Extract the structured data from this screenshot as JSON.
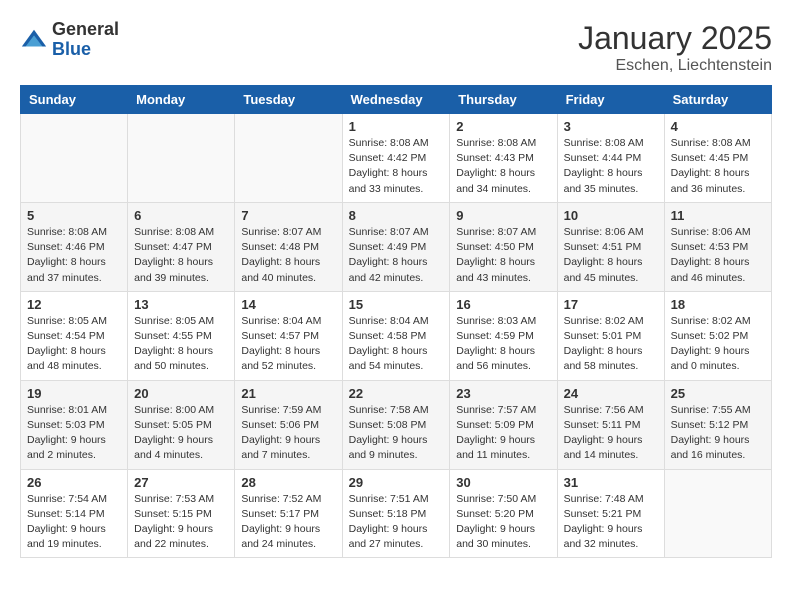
{
  "header": {
    "logo_general": "General",
    "logo_blue": "Blue",
    "month": "January 2025",
    "location": "Eschen, Liechtenstein"
  },
  "weekdays": [
    "Sunday",
    "Monday",
    "Tuesday",
    "Wednesday",
    "Thursday",
    "Friday",
    "Saturday"
  ],
  "weeks": [
    [
      {
        "day": "",
        "info": ""
      },
      {
        "day": "",
        "info": ""
      },
      {
        "day": "",
        "info": ""
      },
      {
        "day": "1",
        "info": "Sunrise: 8:08 AM\nSunset: 4:42 PM\nDaylight: 8 hours\nand 33 minutes."
      },
      {
        "day": "2",
        "info": "Sunrise: 8:08 AM\nSunset: 4:43 PM\nDaylight: 8 hours\nand 34 minutes."
      },
      {
        "day": "3",
        "info": "Sunrise: 8:08 AM\nSunset: 4:44 PM\nDaylight: 8 hours\nand 35 minutes."
      },
      {
        "day": "4",
        "info": "Sunrise: 8:08 AM\nSunset: 4:45 PM\nDaylight: 8 hours\nand 36 minutes."
      }
    ],
    [
      {
        "day": "5",
        "info": "Sunrise: 8:08 AM\nSunset: 4:46 PM\nDaylight: 8 hours\nand 37 minutes."
      },
      {
        "day": "6",
        "info": "Sunrise: 8:08 AM\nSunset: 4:47 PM\nDaylight: 8 hours\nand 39 minutes."
      },
      {
        "day": "7",
        "info": "Sunrise: 8:07 AM\nSunset: 4:48 PM\nDaylight: 8 hours\nand 40 minutes."
      },
      {
        "day": "8",
        "info": "Sunrise: 8:07 AM\nSunset: 4:49 PM\nDaylight: 8 hours\nand 42 minutes."
      },
      {
        "day": "9",
        "info": "Sunrise: 8:07 AM\nSunset: 4:50 PM\nDaylight: 8 hours\nand 43 minutes."
      },
      {
        "day": "10",
        "info": "Sunrise: 8:06 AM\nSunset: 4:51 PM\nDaylight: 8 hours\nand 45 minutes."
      },
      {
        "day": "11",
        "info": "Sunrise: 8:06 AM\nSunset: 4:53 PM\nDaylight: 8 hours\nand 46 minutes."
      }
    ],
    [
      {
        "day": "12",
        "info": "Sunrise: 8:05 AM\nSunset: 4:54 PM\nDaylight: 8 hours\nand 48 minutes."
      },
      {
        "day": "13",
        "info": "Sunrise: 8:05 AM\nSunset: 4:55 PM\nDaylight: 8 hours\nand 50 minutes."
      },
      {
        "day": "14",
        "info": "Sunrise: 8:04 AM\nSunset: 4:57 PM\nDaylight: 8 hours\nand 52 minutes."
      },
      {
        "day": "15",
        "info": "Sunrise: 8:04 AM\nSunset: 4:58 PM\nDaylight: 8 hours\nand 54 minutes."
      },
      {
        "day": "16",
        "info": "Sunrise: 8:03 AM\nSunset: 4:59 PM\nDaylight: 8 hours\nand 56 minutes."
      },
      {
        "day": "17",
        "info": "Sunrise: 8:02 AM\nSunset: 5:01 PM\nDaylight: 8 hours\nand 58 minutes."
      },
      {
        "day": "18",
        "info": "Sunrise: 8:02 AM\nSunset: 5:02 PM\nDaylight: 9 hours\nand 0 minutes."
      }
    ],
    [
      {
        "day": "19",
        "info": "Sunrise: 8:01 AM\nSunset: 5:03 PM\nDaylight: 9 hours\nand 2 minutes."
      },
      {
        "day": "20",
        "info": "Sunrise: 8:00 AM\nSunset: 5:05 PM\nDaylight: 9 hours\nand 4 minutes."
      },
      {
        "day": "21",
        "info": "Sunrise: 7:59 AM\nSunset: 5:06 PM\nDaylight: 9 hours\nand 7 minutes."
      },
      {
        "day": "22",
        "info": "Sunrise: 7:58 AM\nSunset: 5:08 PM\nDaylight: 9 hours\nand 9 minutes."
      },
      {
        "day": "23",
        "info": "Sunrise: 7:57 AM\nSunset: 5:09 PM\nDaylight: 9 hours\nand 11 minutes."
      },
      {
        "day": "24",
        "info": "Sunrise: 7:56 AM\nSunset: 5:11 PM\nDaylight: 9 hours\nand 14 minutes."
      },
      {
        "day": "25",
        "info": "Sunrise: 7:55 AM\nSunset: 5:12 PM\nDaylight: 9 hours\nand 16 minutes."
      }
    ],
    [
      {
        "day": "26",
        "info": "Sunrise: 7:54 AM\nSunset: 5:14 PM\nDaylight: 9 hours\nand 19 minutes."
      },
      {
        "day": "27",
        "info": "Sunrise: 7:53 AM\nSunset: 5:15 PM\nDaylight: 9 hours\nand 22 minutes."
      },
      {
        "day": "28",
        "info": "Sunrise: 7:52 AM\nSunset: 5:17 PM\nDaylight: 9 hours\nand 24 minutes."
      },
      {
        "day": "29",
        "info": "Sunrise: 7:51 AM\nSunset: 5:18 PM\nDaylight: 9 hours\nand 27 minutes."
      },
      {
        "day": "30",
        "info": "Sunrise: 7:50 AM\nSunset: 5:20 PM\nDaylight: 9 hours\nand 30 minutes."
      },
      {
        "day": "31",
        "info": "Sunrise: 7:48 AM\nSunset: 5:21 PM\nDaylight: 9 hours\nand 32 minutes."
      },
      {
        "day": "",
        "info": ""
      }
    ]
  ]
}
